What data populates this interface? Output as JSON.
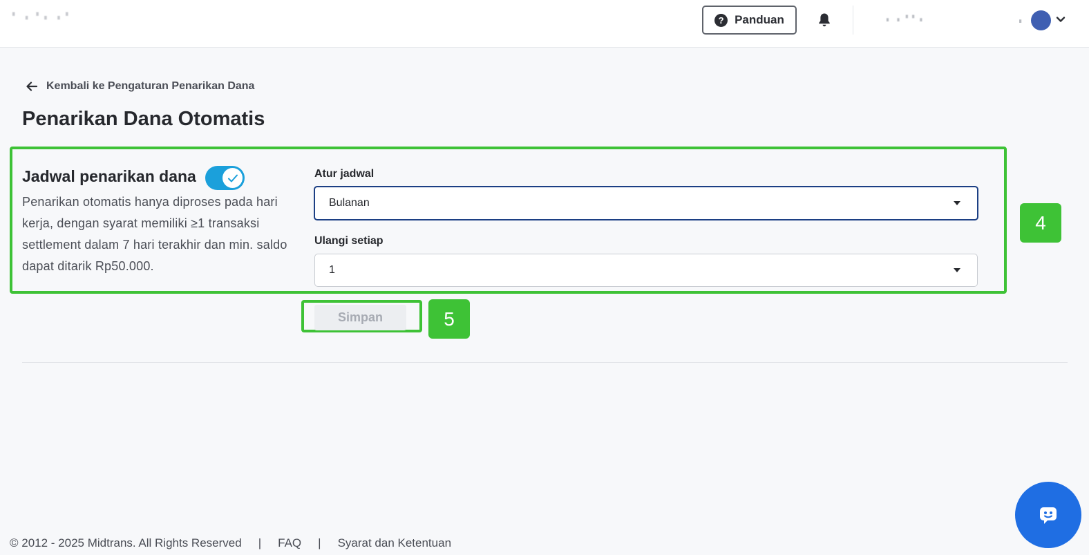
{
  "header": {
    "guide_label": "Panduan",
    "icons": {
      "help": "help-circle-icon",
      "bell": "bell-icon",
      "chevron": "chevron-down-icon"
    }
  },
  "nav": {
    "back_label": "Kembali ke Pengaturan Penarikan Dana",
    "back_icon": "arrow-left-icon"
  },
  "page": {
    "title": "Penarikan Dana Otomatis"
  },
  "schedule": {
    "title": "Jadwal penarikan dana",
    "toggle_on": true,
    "description": "Penarikan otomatis hanya diproses pada hari kerja, dengan syarat memiliki ≥1 transaksi settlement dalam 7 hari terakhir dan min. saldo dapat ditarik Rp50.000.",
    "set_schedule_label": "Atur jadwal",
    "set_schedule_value": "Bulanan",
    "repeat_label": "Ulangi setiap",
    "repeat_value": "1",
    "save_label": "Simpan"
  },
  "annotations": {
    "box_4_label": "4",
    "box_5_label": "5",
    "color": "#3ec236"
  },
  "footer": {
    "copyright": "© 2012 - 2025 Midtrans. All Rights Reserved",
    "separator": "|",
    "faq": "FAQ",
    "terms": "Syarat dan Ketentuan"
  },
  "colors": {
    "toggle": "#1ba0db",
    "chat_button": "#1f6ee3",
    "focus_border": "#1c3f84"
  }
}
